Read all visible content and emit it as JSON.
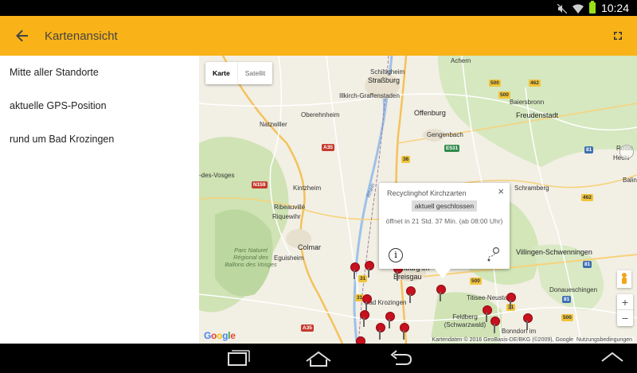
{
  "status_bar": {
    "time": "10:24",
    "icons": [
      "mute-icon",
      "wifi-icon",
      "battery-icon"
    ]
  },
  "toolbar": {
    "title": "Kartenansicht",
    "back_icon": "arrow-back-icon",
    "fullscreen_icon": "fullscreen-icon"
  },
  "sidebar": {
    "items": [
      {
        "label": "Mitte aller Standorte"
      },
      {
        "label": "aktuelle GPS-Position"
      },
      {
        "label": "rund um Bad Krozingen"
      }
    ]
  },
  "map": {
    "type_toggle": {
      "map_label": "Karte",
      "satellite_label": "Satellit"
    },
    "places": {
      "achern": "Achern",
      "schiltigheim": "Schiltigheim",
      "strassburg": "Straßburg",
      "illkirch": "Illkirch-Graffenstaden",
      "baiersbronn": "Baiersbronn",
      "offenburg": "Offenburg",
      "freudenstadt": "Freudenstadt",
      "oberehnheim": "Oberehnheim",
      "natzwiller": "Natzwiller",
      "gengenbach": "Gengenbach",
      "sdesvosges": "-des-Vosges",
      "kintzheim": "Kintzheim",
      "ribeauville": "Ribeauvillé",
      "riquewihr": "Riquewihr",
      "colmar": "Colmar",
      "eguisheim": "Eguisheim",
      "schramberg": "Schramberg",
      "freiburg": "Freiburg im Breisgau",
      "badkrozingen": "Bad Krozingen",
      "titisee": "Titisee-Neustadt",
      "feldberg": "Feldberg (Schwarzwald)",
      "bonndorf": "Bonndorf im",
      "donaueschingen": "Donaueschingen",
      "villingen": "Villingen-Schwenningen",
      "rhein": "Rhein",
      "park": "Parc Naturel Régional des Ballons des Vosges",
      "rottweil": "Rottw",
      "balingen": "Balin",
      "hechingen": "Hechi"
    },
    "road_shields": [
      "A35",
      "N159",
      "A35",
      "E531",
      "500",
      "462",
      "36",
      "31",
      "31",
      "500",
      "31",
      "500",
      "81",
      "81",
      "81",
      "462",
      "500"
    ],
    "popup": {
      "title": "Recyclinghof Kirchzarten",
      "status": "aktuell geschlossen",
      "opening": "öffnet in 21 Std. 37 Min. (ab 08:00 Uhr)",
      "info_label": "i",
      "close_label": "×"
    },
    "google_logo": "Google",
    "copyright": "Kartendaten © 2016 GeoBasis-DE/BKG (©2009), Google",
    "terms": "Nutzungsbedingungen",
    "zoom_in": "+",
    "zoom_out": "−",
    "marker_count": 17
  },
  "nav_bar": {
    "icons": [
      "recent-apps-icon",
      "home-icon",
      "back-icon",
      "keyboard-hide-icon"
    ]
  }
}
